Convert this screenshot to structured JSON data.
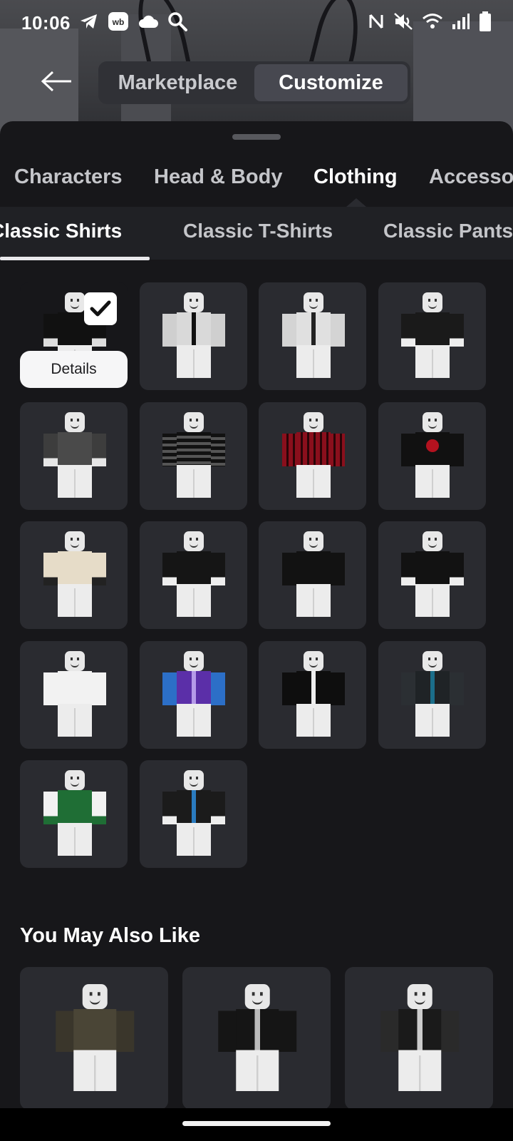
{
  "status_bar": {
    "time": "10:06",
    "left_icons": [
      "telegram-icon",
      "wb-app-icon",
      "cloud-icon",
      "search-icon"
    ],
    "right_icons": [
      "nfc-icon",
      "mute-icon",
      "wifi-icon",
      "signal-icon",
      "battery-icon"
    ]
  },
  "header": {
    "back_icon": "arrow-left-icon",
    "modes": [
      {
        "label": "Marketplace",
        "active": false
      },
      {
        "label": "Customize",
        "active": true
      }
    ]
  },
  "category_tabs": [
    {
      "label": "Characters",
      "active": false
    },
    {
      "label": "Head & Body",
      "active": false
    },
    {
      "label": "Clothing",
      "active": true
    },
    {
      "label": "Accessories",
      "active": false
    }
  ],
  "subcategory_tabs": [
    {
      "label": "Classic Shirts",
      "active": true
    },
    {
      "label": "Classic T-Shirts",
      "active": false
    },
    {
      "label": "Classic Pants",
      "active": false
    }
  ],
  "items": [
    {
      "shirt": "black with white sleeves",
      "selected": true
    },
    {
      "shirt": "white jacket"
    },
    {
      "shirt": "white suit with tie"
    },
    {
      "shirt": "black tee white cuffs"
    },
    {
      "shirt": "grey leather jacket"
    },
    {
      "shirt": "black striped"
    },
    {
      "shirt": "red plaid"
    },
    {
      "shirt": "black spider logo"
    },
    {
      "shirt": "beige varsity"
    },
    {
      "shirt": "black varsity"
    },
    {
      "shirt": "black alo"
    },
    {
      "shirt": "black plain"
    },
    {
      "shirt": "white alo"
    },
    {
      "shirt": "purple vest"
    },
    {
      "shirt": "black suit"
    },
    {
      "shirt": "black leather blue"
    },
    {
      "shirt": "green jersey 8"
    },
    {
      "shirt": "black blue tee"
    }
  ],
  "selected_item": {
    "details_label": "Details",
    "check_icon": "checkmark-icon"
  },
  "recommendations": {
    "title": "You May Also Like",
    "items": [
      {
        "shirt": "camo jacket"
      },
      {
        "shirt": "supreme black"
      },
      {
        "shirt": "black graphic"
      }
    ]
  },
  "colors": {
    "background": "#121215",
    "sheet": "#17171a",
    "tile": "#2a2b30",
    "active_text": "#ffffff",
    "inactive_text": "#c4c5c9"
  }
}
